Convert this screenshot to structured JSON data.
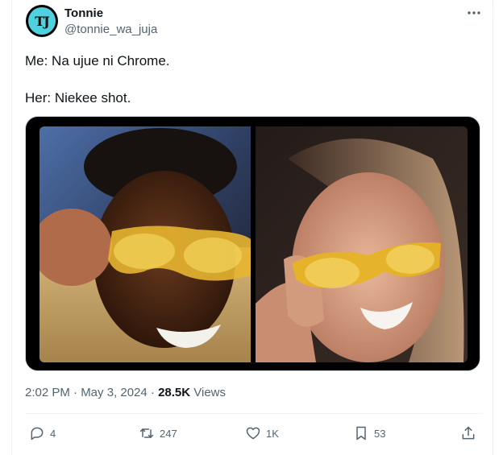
{
  "tweet": {
    "author_name": "Tonnie",
    "author_handle": "@tonnie_wa_juja",
    "avatar_initials": "TJ",
    "text_lines": [
      "Me: Na ujue ni Chrome.",
      "Her: Niekee shot."
    ],
    "timestamp": "2:02 PM · May 3, 2024 · ",
    "views_count": "28.5K",
    "views_label": " Views",
    "more_icon": "more-horizontal-icon"
  },
  "actions": {
    "reply_count": "4",
    "retweet_count": "247",
    "like_count": "1K",
    "bookmark_count": "53"
  },
  "colors": {
    "accent_avatar": "#4fd1e0",
    "secondary_text": "#536471",
    "primary_text": "#0f1419"
  }
}
